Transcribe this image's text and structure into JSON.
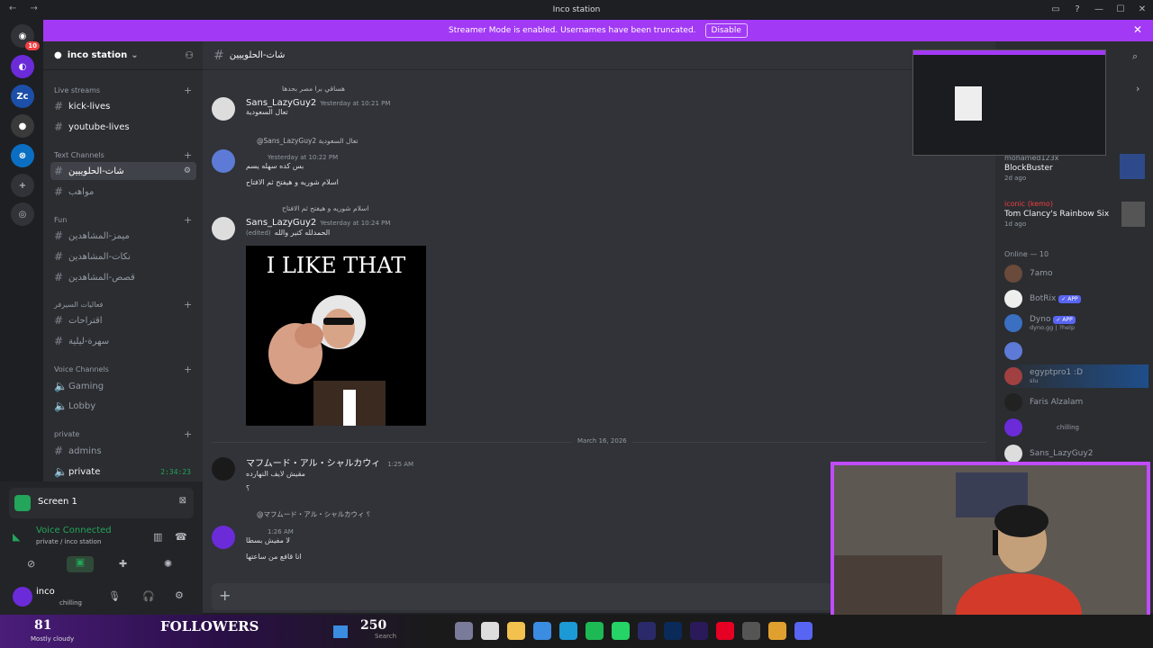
{
  "window": {
    "title": "Inco station",
    "nav": "← →"
  },
  "banner": {
    "text": "Streamer Mode is enabled. Usernames have been truncated.",
    "action": "Disable"
  },
  "guilds": {
    "notification_count": "10"
  },
  "server": {
    "name": "inco station"
  },
  "categories": {
    "live": "Live streams",
    "text": "Text Channels",
    "fun": "Fun",
    "arabic": "فعاليات السيرفر",
    "voice": "Voice Channels",
    "private": "private"
  },
  "channels": {
    "kick": "kick-lives",
    "youtube": "youtube-lives",
    "chat": "شات-الحلوييين",
    "talents": "مواهب",
    "fun1": "ميمز-المشاهدين",
    "fun2": "نكات-المشاهدين",
    "fun3": "قصص-المشاهدين",
    "sugg": "اقتراحات",
    "night": "سهرة-ليلية",
    "gaming": "Gaming",
    "lobby": "Lobby",
    "admins": "admins",
    "private": "private",
    "private_timer": "2:34:23"
  },
  "user_panel": {
    "screen_share": "Screen 1",
    "voice_status": "Voice Connected",
    "voice_location": "private / inco station",
    "username": "inco",
    "user_status": "chilling"
  },
  "chat": {
    "channel_name": "شات-الحلوييين",
    "messages": [
      {
        "reply": "هساقي برا مصر بحدها",
        "author": "Sans_LazyGuy2",
        "time": "Yesterday at 10:21 PM",
        "lines": [
          "تعال السعودية"
        ]
      },
      {
        "reply": "@Sans_LazyGuy2 تعال السعودية",
        "author": "",
        "time": "Yesterday at 10:22 PM",
        "lines": [
          "بس كده سهله يسم",
          "اسلام شوريه و هيفتح ثم الافتاح"
        ]
      },
      {
        "reply": "اسلام شوريه و هيفتح ثم الافتاح",
        "author": "Sans_LazyGuy2",
        "time": "Yesterday at 10:24 PM",
        "lines": [
          "الحمدلله كتير والله"
        ],
        "edited": "(edited)"
      },
      {
        "reply": "",
        "author": "マフムード・アル・シャルカウィ",
        "time": "1:25 AM",
        "lines": [
          "مقيش لايف النهارده",
          "؟"
        ]
      },
      {
        "reply": "@マフムード・アル・シャルカウィ ؟",
        "author": "",
        "time": "1:26 AM",
        "lines": [
          "لا مفيش بسطا",
          "انا قافع من ساعتها"
        ]
      }
    ],
    "image_caption": "I LIKE THAT",
    "date_divider": "March 16, 2026"
  },
  "members": {
    "activity": [
      {
        "name": "mohamed123x",
        "game": "BlockBuster",
        "time": "2d ago"
      },
      {
        "name": "iconic (kemo)",
        "game": "Tom Clancy's Rainbow Six ...",
        "time": "1d ago"
      }
    ],
    "online_header": "Online — 10",
    "online": [
      {
        "name": "7amo",
        "sub": ""
      },
      {
        "name": "BotRix",
        "sub": "",
        "badge": "✓ APP"
      },
      {
        "name": "Dyno",
        "sub": "dyno.gg | ?help",
        "badge": "✓ APP"
      },
      {
        "name": "",
        "sub": ""
      },
      {
        "name": "egyptpro1 :D",
        "sub": "slu"
      },
      {
        "name": "Faris Alzalam",
        "sub": ""
      },
      {
        "name": "",
        "sub": "chilling"
      },
      {
        "name": "Sans_LazyGuy2",
        "sub": ""
      }
    ]
  },
  "taskbar": {
    "followers_count": "81",
    "followers_label": "FOLLOWERS",
    "goal": "250",
    "weather": "Mostly cloudy",
    "search": "Search"
  }
}
